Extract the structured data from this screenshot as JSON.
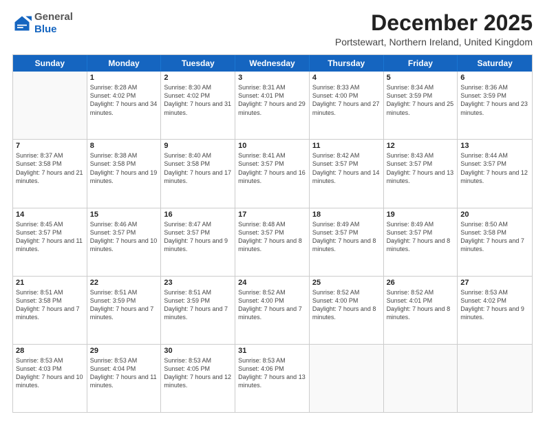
{
  "header": {
    "logo": {
      "general": "General",
      "blue": "Blue"
    },
    "title": "December 2025",
    "location": "Portstewart, Northern Ireland, United Kingdom"
  },
  "weekdays": [
    "Sunday",
    "Monday",
    "Tuesday",
    "Wednesday",
    "Thursday",
    "Friday",
    "Saturday"
  ],
  "weeks": [
    [
      {
        "day": "",
        "empty": true
      },
      {
        "day": "1",
        "sunrise": "8:28 AM",
        "sunset": "4:02 PM",
        "daylight": "7 hours and 34 minutes."
      },
      {
        "day": "2",
        "sunrise": "8:30 AM",
        "sunset": "4:02 PM",
        "daylight": "7 hours and 31 minutes."
      },
      {
        "day": "3",
        "sunrise": "8:31 AM",
        "sunset": "4:01 PM",
        "daylight": "7 hours and 29 minutes."
      },
      {
        "day": "4",
        "sunrise": "8:33 AM",
        "sunset": "4:00 PM",
        "daylight": "7 hours and 27 minutes."
      },
      {
        "day": "5",
        "sunrise": "8:34 AM",
        "sunset": "3:59 PM",
        "daylight": "7 hours and 25 minutes."
      },
      {
        "day": "6",
        "sunrise": "8:36 AM",
        "sunset": "3:59 PM",
        "daylight": "7 hours and 23 minutes."
      }
    ],
    [
      {
        "day": "7",
        "sunrise": "8:37 AM",
        "sunset": "3:58 PM",
        "daylight": "7 hours and 21 minutes."
      },
      {
        "day": "8",
        "sunrise": "8:38 AM",
        "sunset": "3:58 PM",
        "daylight": "7 hours and 19 minutes."
      },
      {
        "day": "9",
        "sunrise": "8:40 AM",
        "sunset": "3:58 PM",
        "daylight": "7 hours and 17 minutes."
      },
      {
        "day": "10",
        "sunrise": "8:41 AM",
        "sunset": "3:57 PM",
        "daylight": "7 hours and 16 minutes."
      },
      {
        "day": "11",
        "sunrise": "8:42 AM",
        "sunset": "3:57 PM",
        "daylight": "7 hours and 14 minutes."
      },
      {
        "day": "12",
        "sunrise": "8:43 AM",
        "sunset": "3:57 PM",
        "daylight": "7 hours and 13 minutes."
      },
      {
        "day": "13",
        "sunrise": "8:44 AM",
        "sunset": "3:57 PM",
        "daylight": "7 hours and 12 minutes."
      }
    ],
    [
      {
        "day": "14",
        "sunrise": "8:45 AM",
        "sunset": "3:57 PM",
        "daylight": "7 hours and 11 minutes."
      },
      {
        "day": "15",
        "sunrise": "8:46 AM",
        "sunset": "3:57 PM",
        "daylight": "7 hours and 10 minutes."
      },
      {
        "day": "16",
        "sunrise": "8:47 AM",
        "sunset": "3:57 PM",
        "daylight": "7 hours and 9 minutes."
      },
      {
        "day": "17",
        "sunrise": "8:48 AM",
        "sunset": "3:57 PM",
        "daylight": "7 hours and 8 minutes."
      },
      {
        "day": "18",
        "sunrise": "8:49 AM",
        "sunset": "3:57 PM",
        "daylight": "7 hours and 8 minutes."
      },
      {
        "day": "19",
        "sunrise": "8:49 AM",
        "sunset": "3:57 PM",
        "daylight": "7 hours and 8 minutes."
      },
      {
        "day": "20",
        "sunrise": "8:50 AM",
        "sunset": "3:58 PM",
        "daylight": "7 hours and 7 minutes."
      }
    ],
    [
      {
        "day": "21",
        "sunrise": "8:51 AM",
        "sunset": "3:58 PM",
        "daylight": "7 hours and 7 minutes."
      },
      {
        "day": "22",
        "sunrise": "8:51 AM",
        "sunset": "3:59 PM",
        "daylight": "7 hours and 7 minutes."
      },
      {
        "day": "23",
        "sunrise": "8:51 AM",
        "sunset": "3:59 PM",
        "daylight": "7 hours and 7 minutes."
      },
      {
        "day": "24",
        "sunrise": "8:52 AM",
        "sunset": "4:00 PM",
        "daylight": "7 hours and 7 minutes."
      },
      {
        "day": "25",
        "sunrise": "8:52 AM",
        "sunset": "4:00 PM",
        "daylight": "7 hours and 8 minutes."
      },
      {
        "day": "26",
        "sunrise": "8:52 AM",
        "sunset": "4:01 PM",
        "daylight": "7 hours and 8 minutes."
      },
      {
        "day": "27",
        "sunrise": "8:53 AM",
        "sunset": "4:02 PM",
        "daylight": "7 hours and 9 minutes."
      }
    ],
    [
      {
        "day": "28",
        "sunrise": "8:53 AM",
        "sunset": "4:03 PM",
        "daylight": "7 hours and 10 minutes."
      },
      {
        "day": "29",
        "sunrise": "8:53 AM",
        "sunset": "4:04 PM",
        "daylight": "7 hours and 11 minutes."
      },
      {
        "day": "30",
        "sunrise": "8:53 AM",
        "sunset": "4:05 PM",
        "daylight": "7 hours and 12 minutes."
      },
      {
        "day": "31",
        "sunrise": "8:53 AM",
        "sunset": "4:06 PM",
        "daylight": "7 hours and 13 minutes."
      },
      {
        "day": "",
        "empty": true
      },
      {
        "day": "",
        "empty": true
      },
      {
        "day": "",
        "empty": true
      }
    ]
  ]
}
